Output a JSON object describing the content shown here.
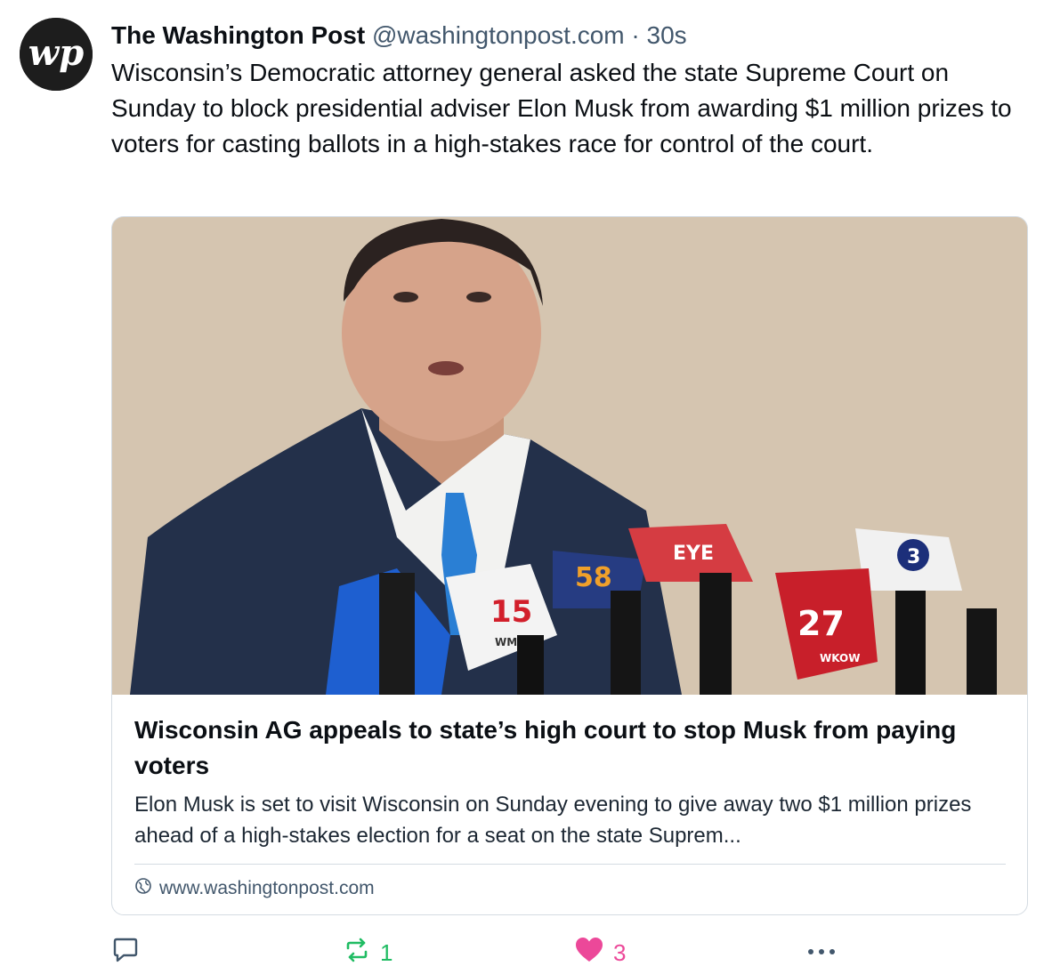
{
  "post": {
    "author": "The Washington Post",
    "handle": "@washingtonpost.com",
    "separator": "·",
    "time": "30s",
    "avatar_icon": "washington-post-logo",
    "text": "Wisconsin’s Democratic attorney general asked the state Supreme Court on Sunday to block presidential adviser Elon Musk from awarding $1 million prizes to voters for casting ballots in a high-stakes race for control of the court."
  },
  "card": {
    "title": "Wisconsin AG appeals to state’s high court to stop Musk from paying voters",
    "description": "Elon Musk is set to visit Wisconsin on Sunday evening to give away two $1 million prizes ahead of a high-stakes election for a seat on the state Suprem...",
    "url": "www.washingtonpost.com",
    "url_icon": "globe-icon",
    "mic_labels": [
      "15",
      "WMTV",
      "58",
      "EYE",
      "3",
      "27",
      "WKOW"
    ]
  },
  "actions": {
    "reply_count": "",
    "repost_count": "1",
    "like_count": "3",
    "colors": {
      "repost": "#20bc63",
      "like": "#ec4899",
      "muted": "#42576c"
    }
  }
}
